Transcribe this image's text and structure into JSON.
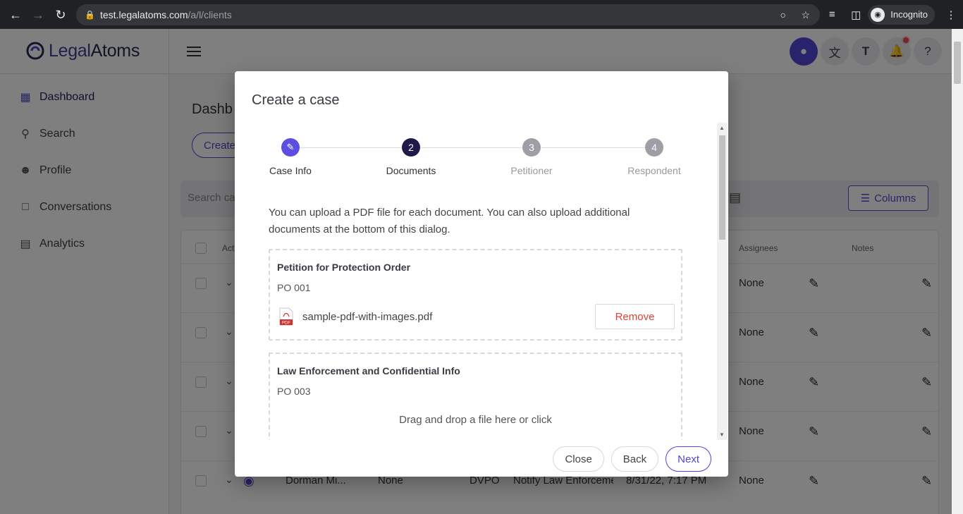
{
  "browser": {
    "url_host": "test.legalatoms.com",
    "url_path": "/a/l/clients",
    "profile_label": "Incognito"
  },
  "app": {
    "logo_text_a": "Legal",
    "logo_text_b": "Atoms",
    "header_actions": [
      "account-icon",
      "translate-icon",
      "text-size-icon",
      "bell-icon",
      "help-icon"
    ]
  },
  "sidebar": {
    "items": [
      {
        "label": "Dashboard",
        "icon": "dashboard-icon",
        "active": true
      },
      {
        "label": "Search",
        "icon": "search-icon"
      },
      {
        "label": "Profile",
        "icon": "person-icon"
      },
      {
        "label": "Conversations",
        "icon": "chat-icon"
      },
      {
        "label": "Analytics",
        "icon": "analytics-icon"
      }
    ]
  },
  "main": {
    "title_partial": "Dashb",
    "create_partial": "Create",
    "search_placeholder_partial": "Search ca",
    "columns_label": "Columns",
    "headers": {
      "actions_partial": "Act",
      "assignees": "Assignees",
      "notes": "Notes"
    },
    "rows": [
      {
        "assignees": "None"
      },
      {
        "assignees": "None"
      },
      {
        "assignees": "None"
      },
      {
        "assignees": "None"
      },
      {
        "name": "Dorman Mi...",
        "col2": "None",
        "type": "DVPO",
        "status": "Notify Law Enforceme",
        "date": "8/31/22, 7:17 PM",
        "assignees": "None"
      }
    ]
  },
  "modal": {
    "title": "Create a case",
    "steps": [
      {
        "label": "Case Info",
        "marker": "✎",
        "state": "done"
      },
      {
        "label": "Documents",
        "marker": "2",
        "state": "current"
      },
      {
        "label": "Petitioner",
        "marker": "3",
        "state": "todo"
      },
      {
        "label": "Respondent",
        "marker": "4",
        "state": "todo"
      }
    ],
    "intro": "You can upload a PDF file for each document. You can also upload additional documents at the bottom of this dialog.",
    "documents": [
      {
        "title": "Petition for Protection Order",
        "code": "PO 001",
        "file": "sample-pdf-with-images.pdf",
        "remove_label": "Remove"
      },
      {
        "title": "Law Enforcement and Confidential Info",
        "code": "PO 003",
        "drop_text": "Drag and drop a file here or click"
      }
    ],
    "buttons": {
      "close": "Close",
      "back": "Back",
      "next": "Next"
    }
  },
  "colors": {
    "accent": "#5346d6",
    "step_current": "#1e1b4b",
    "step_todo": "#9e9ea6",
    "remove": "#e0403a"
  }
}
